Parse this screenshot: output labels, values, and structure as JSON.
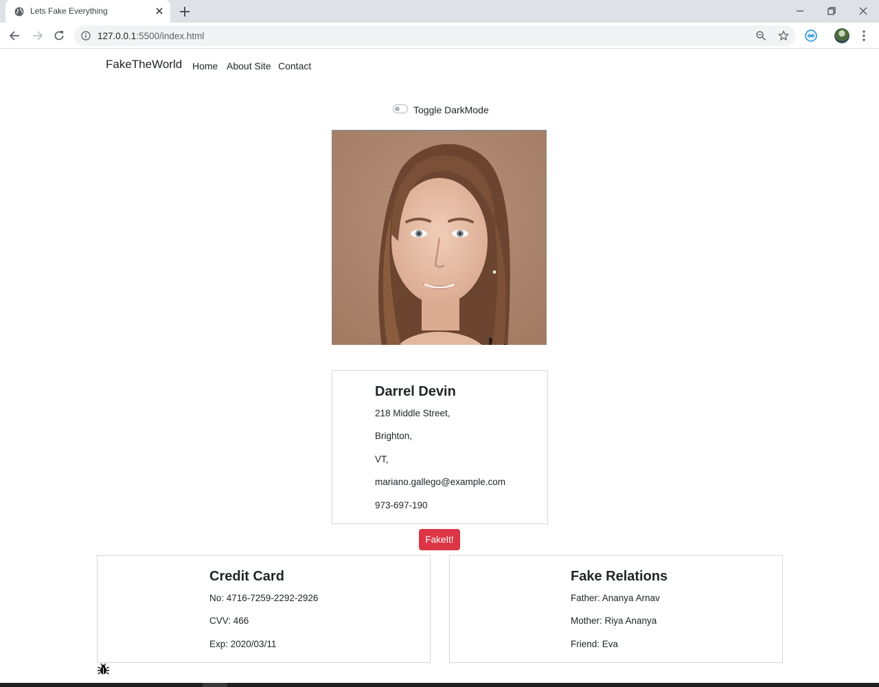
{
  "browser": {
    "tab_title": "Lets Fake Everything",
    "url_host": "127.0.0.1",
    "url_rest": ":5500/index.html"
  },
  "navbar": {
    "brand": "FakeTheWorld",
    "links": [
      "Home",
      "About Site",
      "Contact"
    ]
  },
  "darkmode": {
    "label": "Toggle DarkMode",
    "enabled": false
  },
  "profile": {
    "name": "Darrel Devin",
    "street": "218 Middle Street,",
    "city": "Brighton,",
    "state": "VT,",
    "email": "mariano.gallego@example.com",
    "phone": "973-697-190"
  },
  "action": {
    "button_label": "FakeIt!"
  },
  "credit_card": {
    "heading": "Credit Card",
    "number": "No: 4716-7259-2292-2926",
    "cvv": "CVV: 466",
    "exp": "Exp: 2020/03/11"
  },
  "relations": {
    "heading": "Fake Relations",
    "father": "Father: Ananya Arnav",
    "mother": "Mother: Riya Ananya",
    "friend": "Friend: Eva"
  },
  "colors": {
    "button": "#dc3545",
    "tabstrip": "#dee1e6"
  },
  "icons": [
    "globe-icon",
    "close-icon",
    "plus-icon",
    "minimize-icon",
    "restore-icon",
    "back-icon",
    "forward-icon",
    "reload-icon",
    "info-icon",
    "zoom-icon",
    "star-icon",
    "extension-icon",
    "menu-icon",
    "bug-icon"
  ]
}
